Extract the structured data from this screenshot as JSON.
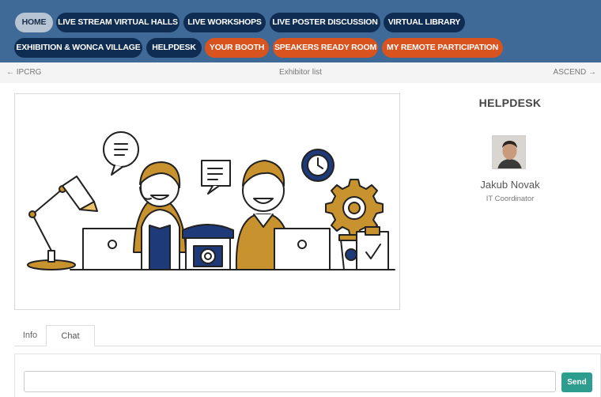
{
  "nav": {
    "row1": [
      "HOME",
      "LIVE STREAM VIRTUAL HALLS",
      "LIVE WORKSHOPS",
      "LIVE POSTER DISCUSSION",
      "VIRTUAL LIBRARY"
    ],
    "row2": [
      "EXHIBITION & WONCA VILLAGE",
      "HELPDESK",
      "YOUR BOOTH",
      "SPEAKERS READY ROOM",
      "MY REMOTE PARTICIPATION"
    ],
    "active": "HOME",
    "colors": {
      "bar": "#3f6a98",
      "navy_pill": "#0f2d52",
      "orange_pill": "#d9531e",
      "home_pill": "#b6c4d4"
    }
  },
  "breadcrumb": {
    "prev": "← IPCRG",
    "center": "Exhibitor list",
    "next": "ASCEND →"
  },
  "booth": {
    "image_icon": "helpdesk-illustration",
    "title": "HELPDESK",
    "contact": {
      "name": "Jakub Novak",
      "role": "IT Coordinator",
      "avatar_icon": "person-avatar"
    }
  },
  "tabs": [
    "Info",
    "Chat"
  ],
  "active_tab": "Chat",
  "chat": {
    "input_value": "",
    "input_placeholder": "",
    "send_label": "Send",
    "send_color": "#2d9d8f"
  }
}
